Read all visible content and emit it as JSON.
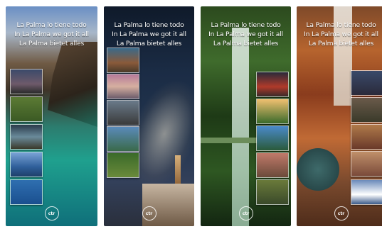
{
  "panels": [
    {
      "id": "p1",
      "headline": [
        "La Palma lo tiene todo",
        "In La Palma we got it all",
        "La Palma bietet alles"
      ],
      "logo": "ctr"
    },
    {
      "id": "p2",
      "headline": [
        "La Palma lo tiene todo",
        "In La Palma we got it all",
        "La Palma bietet alles"
      ],
      "logo": "ctr"
    },
    {
      "id": "p3",
      "headline": [
        "La Palma lo tiene todo",
        "In La Palma we got it all",
        "La Palma bietet alles"
      ],
      "logo": "ctr"
    },
    {
      "id": "p4",
      "headline": [
        "La Palma lo tiene todo",
        "In La Palma we got it all",
        "La Palma bietet alles"
      ],
      "logo": "ctr"
    }
  ]
}
